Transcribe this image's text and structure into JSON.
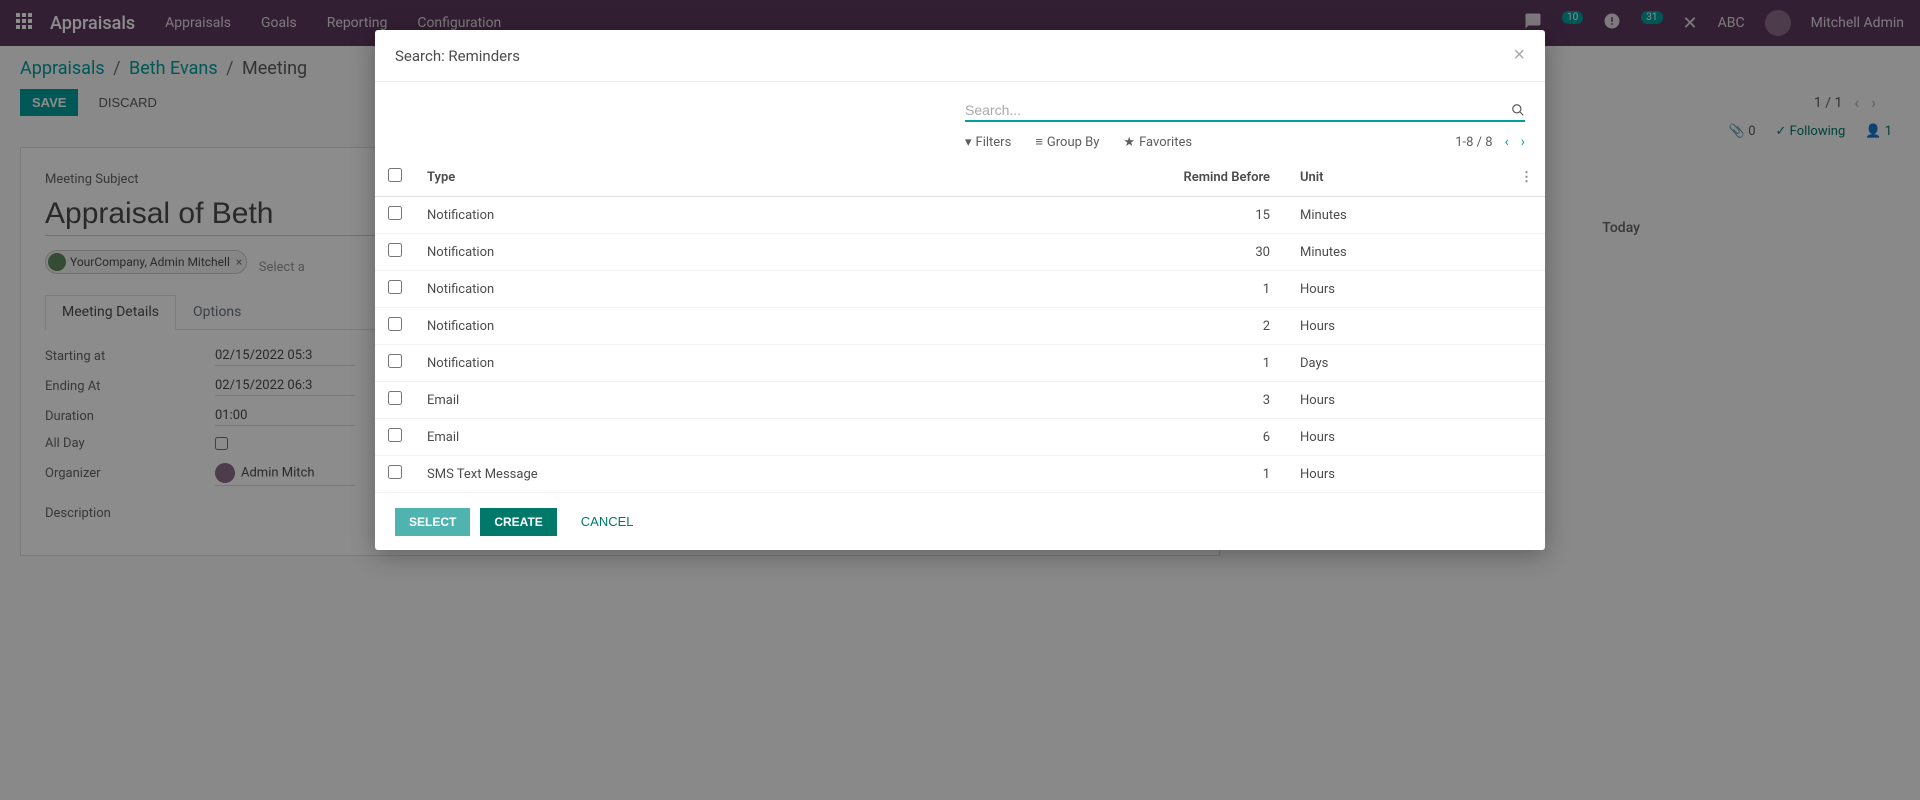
{
  "topnav": {
    "brand": "Appraisals",
    "menu": [
      "Appraisals",
      "Goals",
      "Reporting",
      "Configuration"
    ],
    "badge1": "10",
    "badge2": "31",
    "company": "ABC",
    "user": "Mitchell Admin"
  },
  "breadcrumbs": {
    "items": [
      "Appraisals",
      "Beth Evans"
    ],
    "current": "Meeting"
  },
  "actions": {
    "save": "SAVE",
    "discard": "DISCARD",
    "pager": "1 / 1"
  },
  "status": {
    "attachments": "0",
    "following": "Following",
    "followers": "1"
  },
  "form": {
    "subject_label": "Meeting Subject",
    "subject_value": "Appraisal of Beth",
    "attendee_tag": "YourCompany, Admin Mitchell",
    "attendee_placeholder": "Select a",
    "tabs": {
      "details": "Meeting Details",
      "options": "Options"
    },
    "fields": {
      "start_label": "Starting at",
      "start_val": "02/15/2022 05:3",
      "end_label": "Ending At",
      "end_val": "02/15/2022 06:3",
      "duration_label": "Duration",
      "duration_val": "01:00",
      "allday_label": "All Day",
      "organizer_label": "Organizer",
      "organizer_val": "Admin Mitch",
      "description_label": "Description"
    }
  },
  "today": "Today",
  "modal": {
    "title": "Search: Reminders",
    "search_placeholder": "Search...",
    "filters": "Filters",
    "groupby": "Group By",
    "favorites": "Favorites",
    "pager": "1-8 / 8",
    "columns": {
      "type": "Type",
      "remind": "Remind Before",
      "unit": "Unit"
    },
    "rows": [
      {
        "type": "Notification",
        "remind": "15",
        "unit": "Minutes"
      },
      {
        "type": "Notification",
        "remind": "30",
        "unit": "Minutes"
      },
      {
        "type": "Notification",
        "remind": "1",
        "unit": "Hours"
      },
      {
        "type": "Notification",
        "remind": "2",
        "unit": "Hours"
      },
      {
        "type": "Notification",
        "remind": "1",
        "unit": "Days"
      },
      {
        "type": "Email",
        "remind": "3",
        "unit": "Hours"
      },
      {
        "type": "Email",
        "remind": "6",
        "unit": "Hours"
      },
      {
        "type": "SMS Text Message",
        "remind": "1",
        "unit": "Hours"
      }
    ],
    "footer": {
      "select": "SELECT",
      "create": "CREATE",
      "cancel": "CANCEL"
    }
  }
}
